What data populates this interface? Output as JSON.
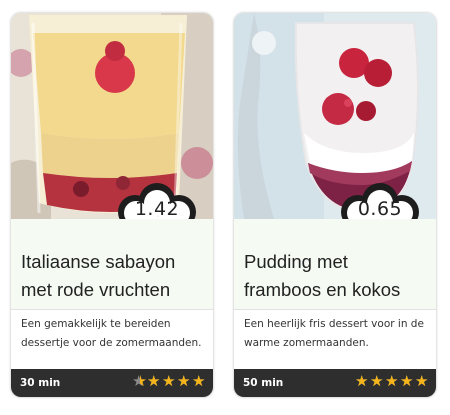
{
  "colors": {
    "card_title_bg": "#f5fbf3",
    "footer_bg": "#2e2e2e",
    "star_color": "#f4b41a"
  },
  "recipes": [
    {
      "score": "1.42",
      "title": "Italiaanse sabayon met rode vruchten",
      "description": "Een gemakkelijk te bereiden dessertje voor de zomermaanden.",
      "time": "30 min",
      "rating": 4.5,
      "rating_max": 5,
      "image_icon": "sabayon-dessert-photo"
    },
    {
      "score": "0.65",
      "title": "Pudding met framboos en kokos",
      "description": "Een heerlijk fris dessert voor in de warme zomermaanden.",
      "time": "50 min",
      "rating": 5,
      "rating_max": 5,
      "image_icon": "pudding-dessert-photo"
    }
  ]
}
